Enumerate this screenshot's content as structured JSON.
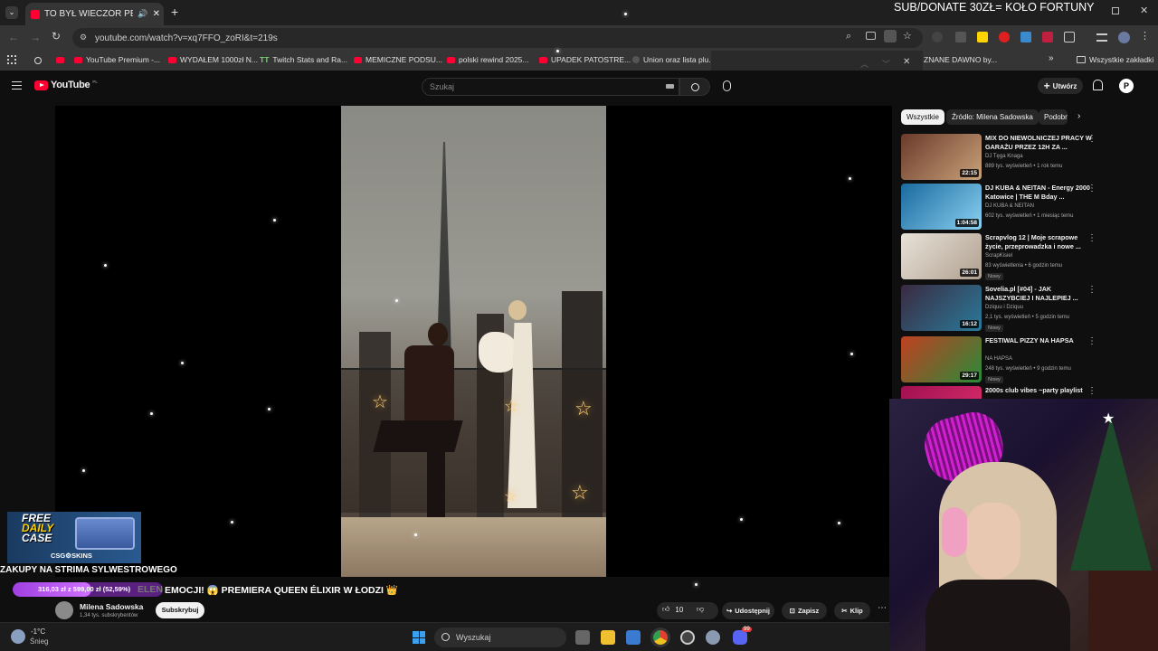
{
  "overlay_top": "SUB/DONATE 30ZŁ= KOŁO FORTUNY",
  "browser": {
    "tab_title": "TO BYŁ WIECZÓR PEŁEN EM",
    "url": "youtube.com/watch?v=xq7FFO_zoRI&t=219s",
    "bookmarks": [
      "YouTube Premium -...",
      "WYDAŁEM 1000zł N...",
      "Twitch Stats and Ra...",
      "MEMICZNE PODSU...",
      "polski rewind 2025...",
      "UPADEK PATOSTRE...",
      "Union oraz lista plu...",
      "ZNANE DAWNO by..."
    ],
    "all_bookmarks": "Wszystkie zakładki"
  },
  "youtube": {
    "logo": "YouTube",
    "logo_sup": "PL",
    "search_placeholder": "Szukaj",
    "create": "Utwórz",
    "chips": [
      "Wszystkie",
      "Źródło: Milena Sadowska",
      "Podobne"
    ],
    "recs": [
      {
        "title": "MIX DO NIEWOLNICZEJ PRACY W GARAŻU PRZEZ 12H ZA ...",
        "channel": "DJ Tęga Knaga",
        "meta": "889 tys. wyświetleń • 1 rok temu",
        "dur": "22:15",
        "badge": "",
        "c1": "#6a3a2a",
        "c2": "#c9a27a"
      },
      {
        "title": "DJ KUBA & NEITAN - Energy 2000 Katowice | THE M Bday ...",
        "channel": "DJ KUBA & NEITAN",
        "meta": "602 tys. wyświetleń • 1 miesiąc temu",
        "dur": "1:04:58",
        "badge": "",
        "c1": "#1a6aa0",
        "c2": "#8ad0f0"
      },
      {
        "title": "Scrapvlog 12 | Moje scrapowe życie, przeprowadzka i nowe ...",
        "channel": "ScrapKisiel",
        "meta": "83 wyświetlenia • 6 godzin temu",
        "dur": "26:01",
        "badge": "Nowy",
        "c1": "#e8e2d8",
        "c2": "#b0a090"
      },
      {
        "title": "Sovelia.pl [#04] - JAK NAJSZYBCIEJ I NAJLEPIEJ ...",
        "channel": "Dziquu i Dziquu",
        "meta": "2,1 tys. wyświetleń • 5 godzin temu",
        "dur": "16:12",
        "badge": "Nowy",
        "c1": "#3a2a40",
        "c2": "#2a7a9a"
      },
      {
        "title": "FESTIWAL PIZZY NA HAPSA",
        "channel": "NA HAPSA",
        "meta": "248 tys. wyświetleń • 9 godzin temu",
        "dur": "29:17",
        "badge": "Nowy",
        "c1": "#c04020",
        "c2": "#2a8a3a"
      },
      {
        "title": "2000s club vibes ~party playlist",
        "channel": "",
        "meta": "",
        "dur": "",
        "badge": "",
        "c1": "#a01050",
        "c2": "#e03070"
      }
    ],
    "channel_name": "Milena Sadowska",
    "subs": "1,34 tys. subskrybentów",
    "subscribe": "Subskrybuj",
    "likes": "10",
    "share": "Udostępnij",
    "save": "Zapisz",
    "clip": "Klip"
  },
  "stream": {
    "ticker": "ZAKUPY NA STRIMA SYLWESTROWEGO",
    "goal": "316,03 zł z 599,00 zł (52,59%)",
    "goal_fraction": 0.5259,
    "marquee": "EMOCJI! 😱 PREMIERA QUEEN ÉLIXIR W ŁODZI 👑",
    "marquee_dim": "ELEN",
    "ad_lines": [
      "FREE",
      "DAILY",
      "CASE"
    ],
    "ad_brand": "CSG⚙SKINS"
  },
  "taskbar": {
    "weather_temp": "-1°C",
    "weather_desc": "Śnieg",
    "search": "Wyszukaj",
    "discord_badge": "99"
  }
}
